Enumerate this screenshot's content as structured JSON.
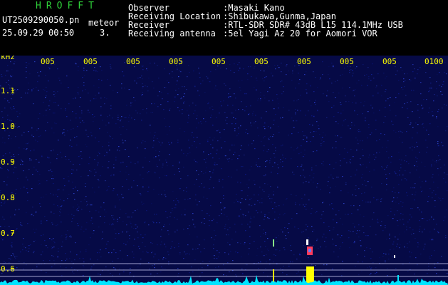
{
  "header": {
    "brand": "HROFFT",
    "filename": "UT2509290050.pn",
    "meteor_label": "meteor",
    "datetime": "25.09.29 00:50",
    "count": "3.",
    "fields": [
      {
        "label": "Observer",
        "value": ":Masaki Kano"
      },
      {
        "label": "Receiving Location",
        "value": ":Shibukawa,Gunma,Japan"
      },
      {
        "label": "Receiver",
        "value": ":RTL-SDR SDR# 43dB L15 114.1MHz USB"
      },
      {
        "label": "Receiving antenna",
        "value": ":5el Yagi Az 20 for Aomori VOR"
      }
    ]
  },
  "axis": {
    "unit": "kHz",
    "y_ticks": [
      "1.1",
      "1.0",
      "0.9",
      "0.8",
      "0.7",
      "0.6"
    ],
    "x_ticks": [
      "005",
      "005",
      "005",
      "005",
      "005",
      "005",
      "005",
      "005",
      "005",
      "0100"
    ]
  },
  "colors": {
    "background": "#000000",
    "brand": "#2fd13a",
    "label_text": "#ffffff",
    "axis_text": "#ffff00",
    "noise_base": "#0a0f5a",
    "signal": "#00e5ff",
    "meteor": "#ffff00"
  }
}
